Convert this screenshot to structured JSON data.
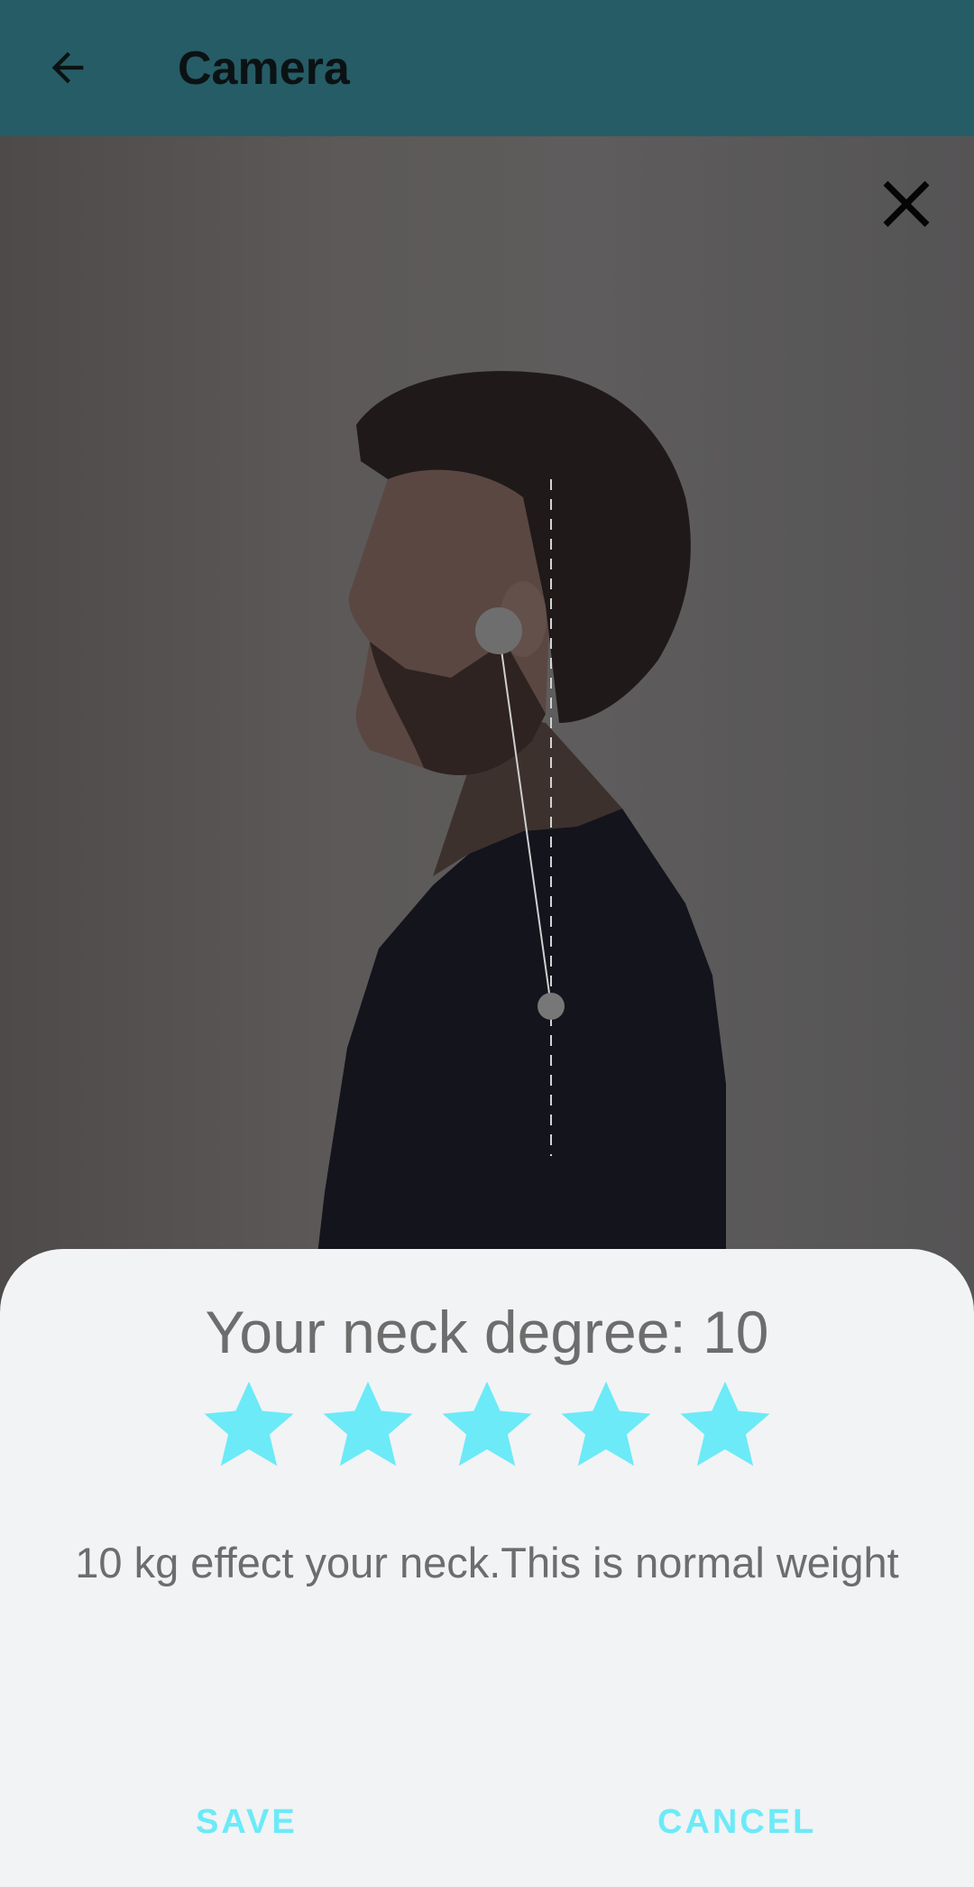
{
  "app_bar": {
    "title": "Camera",
    "back_icon": "arrow-back-icon",
    "background": "#265c66"
  },
  "photo": {
    "close_icon": "close-icon"
  },
  "result": {
    "degree_text": "Your neck degree: 10",
    "rating": 5,
    "rating_max": 5,
    "star_color": "#6ceaf7",
    "effect_text": "10 kg effect your neck.This is normal weight"
  },
  "actions": {
    "save_label": "SAVE",
    "cancel_label": "CANCEL",
    "accent": "#6ceaf7"
  }
}
